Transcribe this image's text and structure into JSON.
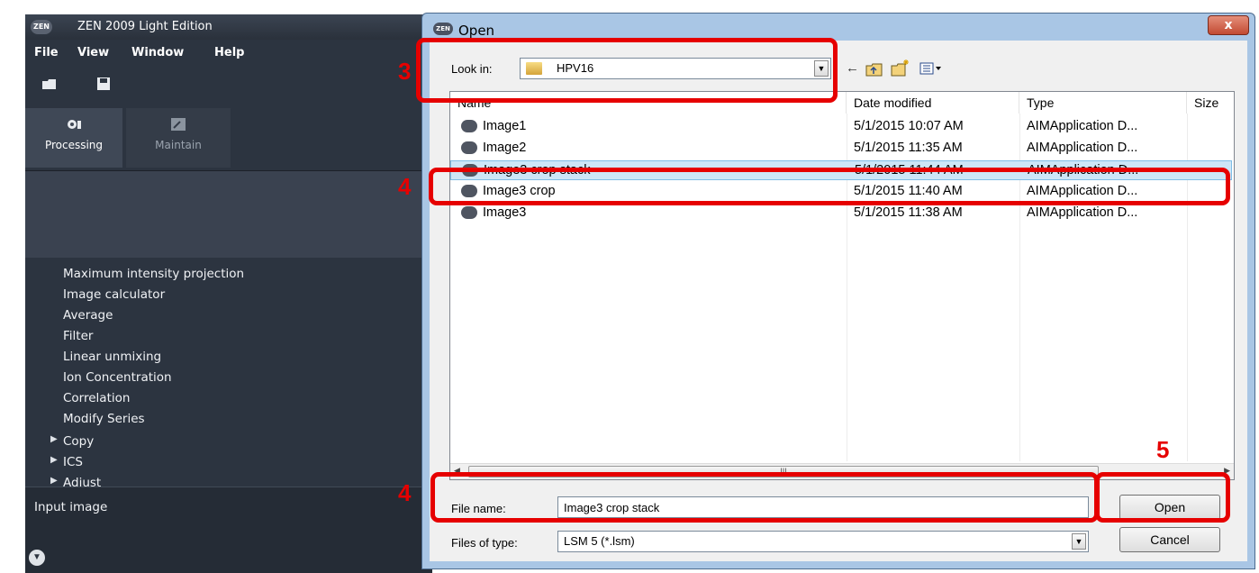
{
  "main_window": {
    "logo": "ZEN",
    "title": "ZEN 2009 Light Edition",
    "menu": [
      "File",
      "View",
      "Window",
      "Help"
    ],
    "toolbar_icons": [
      "open-folder-icon",
      "save-icon"
    ],
    "tabs": [
      {
        "label": "Processing",
        "icon": "gear-icon",
        "active": true
      },
      {
        "label": "Maintain",
        "icon": "wrench-icon",
        "active": false
      }
    ],
    "processing_items": [
      "Maximum intensity projection",
      "Image calculator",
      "Average",
      "Filter",
      "Linear unmixing",
      "Ion Concentration",
      "Correlation",
      "Modify Series"
    ],
    "expandable_items": [
      "Copy",
      "ICS",
      "Adjust"
    ],
    "input_section_label": "Input image"
  },
  "dialog": {
    "logo": "ZEN",
    "title": "Open",
    "close_label": "x",
    "look_in_label": "Look in:",
    "look_in_value": "HPV16",
    "nav_icons": [
      "back-arrow-icon",
      "up-folder-icon",
      "new-folder-icon",
      "view-menu-icon"
    ],
    "columns": [
      "Name",
      "Date modified",
      "Type",
      "Size"
    ],
    "files": [
      {
        "name": "Image1",
        "date": "5/1/2015 10:07 AM",
        "type": "AIMApplication D..."
      },
      {
        "name": "Image2",
        "date": "5/1/2015 11:35 AM",
        "type": "AIMApplication D..."
      },
      {
        "name": "Image3 crop stack",
        "date": "5/1/2015 11:44 AM",
        "type": "AIMApplication D..."
      },
      {
        "name": "Image3 crop",
        "date": "5/1/2015 11:40 AM",
        "type": "AIMApplication D..."
      },
      {
        "name": "Image3",
        "date": "5/1/2015 11:38 AM",
        "type": "AIMApplication D..."
      }
    ],
    "selected_file": "Image3 crop stack",
    "file_name_label": "File name:",
    "file_name_value": "Image3 crop stack",
    "files_of_type_label": "Files of type:",
    "files_of_type_value": "LSM 5 (*.lsm)",
    "open_button": "Open",
    "cancel_button": "Cancel",
    "scrollbar_grip": "III"
  },
  "annotations": {
    "color": "#e60000",
    "labels": [
      "3",
      "4",
      "4",
      "5"
    ]
  }
}
